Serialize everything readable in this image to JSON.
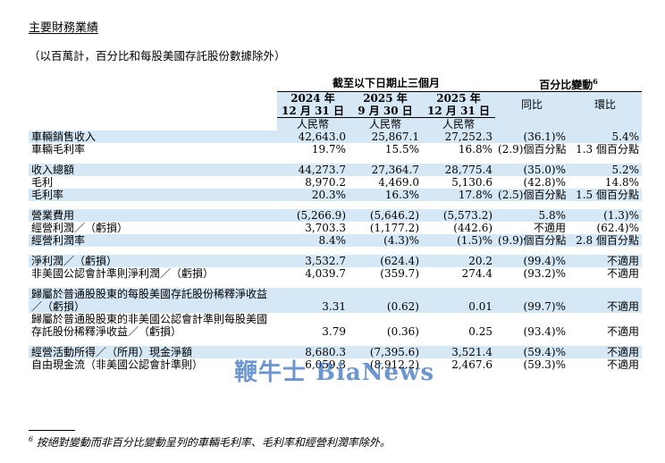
{
  "title": "主要財務業績",
  "subtitle": "（以百萬計，百分比和每股美國存託股份數據除外）",
  "header": {
    "period_group": "截至以下日期止三個月",
    "change_group": "百分比變動",
    "change_sup": "6",
    "periods": [
      {
        "year": "2024 年",
        "date": "12 月 31 日",
        "currency": "人民幣"
      },
      {
        "year": "2025 年",
        "date": "9 月 30 日",
        "currency": "人民幣"
      },
      {
        "year": "2025 年",
        "date": "12 月 31 日",
        "currency": "人民幣"
      }
    ],
    "yoy": "同比",
    "qoq": "環比"
  },
  "rows": [
    {
      "label": "車輛銷售收入",
      "v1": "42,643.0",
      "v2": "25,867.1",
      "v3": "27,252.3",
      "yoy": "(36.1)%",
      "qoq": "5.4%",
      "shade": true
    },
    {
      "label": "車輛毛利率",
      "v1": "19.7%",
      "v2": "15.5%",
      "v3": "16.8%",
      "yoy": "(2.9)個百分點",
      "qoq": "1.3 個百分點",
      "shade": false
    },
    {
      "label": "收入總額",
      "v1": "44,273.7",
      "v2": "27,364.7",
      "v3": "28,775.4",
      "yoy": "(35.0)%",
      "qoq": "5.2%",
      "shade": true
    },
    {
      "label": "毛利",
      "v1": "8,970.2",
      "v2": "4,469.0",
      "v3": "5,130.6",
      "yoy": "(42.8)%",
      "qoq": "14.8%",
      "shade": false
    },
    {
      "label": "毛利率",
      "v1": "20.3%",
      "v2": "16.3%",
      "v3": "17.8%",
      "yoy": "(2.5)個百分點",
      "qoq": "1.5 個百分點",
      "shade": true
    },
    {
      "label": "營業費用",
      "v1": "(5,266.9)",
      "v2": "(5,646.2)",
      "v3": "(5,573.2)",
      "yoy": "5.8%",
      "qoq": "(1.3)%",
      "shade": true
    },
    {
      "label": "經營利潤／（虧損）",
      "v1": "3,703.3",
      "v2": "(1,177.2)",
      "v3": "(442.6)",
      "yoy": "不適用",
      "qoq": "(62.4)%",
      "shade": false
    },
    {
      "label": "經營利潤率",
      "v1": "8.4%",
      "v2": "(4.3)%",
      "v3": "(1.5)%",
      "yoy": "(9.9)個百分點",
      "qoq": "2.8 個百分點",
      "shade": true
    },
    {
      "label": "淨利潤／（虧損）",
      "v1": "3,532.7",
      "v2": "(624.4)",
      "v3": "20.2",
      "yoy": "(99.4)%",
      "qoq": "不適用",
      "shade": true
    },
    {
      "label": "非美國公認會計準則淨利潤／（虧損）",
      "v1": "4,039.7",
      "v2": "(359.7)",
      "v3": "274.4",
      "yoy": "(93.2)%",
      "qoq": "不適用",
      "shade": false
    },
    {
      "label": "歸屬於普通股股東的每股美國存託股份稀釋淨收益／（虧損）",
      "v1": "3.31",
      "v2": "(0.62)",
      "v3": "0.01",
      "yoy": "(99.7)%",
      "qoq": "不適用",
      "shade": true
    },
    {
      "label": "歸屬於普通股股東的非美國公認會計準則每股美國存託股份稀釋淨收益／（虧損）",
      "v1": "3.79",
      "v2": "(0.36)",
      "v3": "0.25",
      "yoy": "(93.4)%",
      "qoq": "不適用",
      "shade": false
    },
    {
      "label": "經營活動所得／（所用）現金淨額",
      "v1": "8,680.3",
      "v2": "(7,395.6)",
      "v3": "3,521.4",
      "yoy": "(59.4)%",
      "qoq": "不適用",
      "shade": true
    },
    {
      "label": "自由現金流（非美國公認會計準則）",
      "v1": "6,059.3",
      "v2": "(8,912.2)",
      "v3": "2,467.6",
      "yoy": "(59.3)%",
      "qoq": "不適用",
      "shade": false
    }
  ],
  "footnote": {
    "sup": "6",
    "text": "按絕對變動而非百分比變動呈列的車輛毛利率、毛利率和經營利潤率除外。"
  },
  "watermark": "鞭牛士 BiaNews"
}
